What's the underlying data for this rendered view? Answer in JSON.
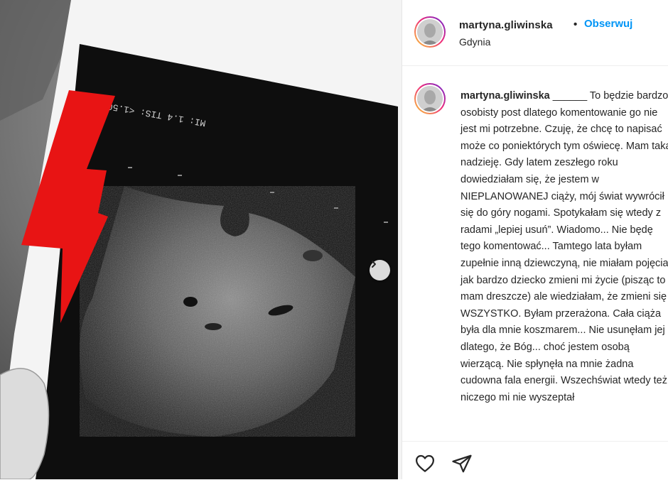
{
  "post": {
    "username": "martyna.gliwinska",
    "separator": "•",
    "follow_label": "Obserwuj",
    "location": "Gdynia"
  },
  "caption": {
    "username": "martyna.gliwinska",
    "text": "______ To będzie bardzo osobisty post dlatego komentowanie go nie jest mi potrzebne. Czuję, że chcę to napisać może co poniektórych tym oświecę. Mam taką nadzieję. Gdy latem zeszłego roku dowiedziałam się, że jestem w NIEPLANOWANEJ ciąży, mój świat wywrócił się do góry nogami. Spotykałam się wtedy z radami „lepiej usuń”. Wiadomo... Nie będę tego komentować... Tamtego lata byłam zupełnie inną dziewczyną, nie miałam pojęcia jak bardzo dziecko zmieni mi życie (pisząc to mam dreszcze) ale wiedziałam, że zmieni się WSZYSTKO. Byłam przerażona. Cała ciąża była dla mnie koszmarem... Nie usunęłam jej dlatego, że Bóg... choć jestem osobą wierzącą. Nie spłynęła na mnie żadna cudowna fala energii. Wszechświat wtedy też niczego mi nie wyszeptał"
  },
  "media": {
    "scan_label": "MI: 1.4 TIS: <1.50"
  },
  "icons": {
    "next": "chevron-right-icon",
    "like": "heart-icon",
    "share": "paper-plane-icon"
  },
  "colors": {
    "follow": "#0095f6",
    "text": "#262626",
    "bolt": "#e81414"
  }
}
